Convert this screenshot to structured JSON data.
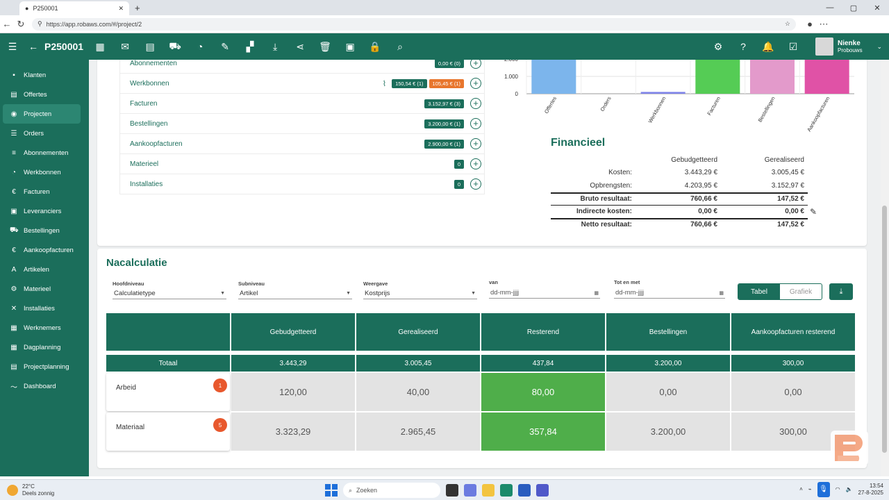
{
  "browser": {
    "tab_title": "P250001",
    "url": "https://app.robaws.com/#/project/2"
  },
  "appbar": {
    "project_code": "P250001",
    "user_name": "Nienke",
    "user_company": "Probouws"
  },
  "sidebar": {
    "items": [
      {
        "label": "Klanten",
        "icon": "person-icon"
      },
      {
        "label": "Offertes",
        "icon": "document-icon"
      },
      {
        "label": "Projecten",
        "icon": "project-icon",
        "active": true
      },
      {
        "label": "Orders",
        "icon": "list-icon"
      },
      {
        "label": "Abonnementen",
        "icon": "subscription-icon"
      },
      {
        "label": "Werkbonnen",
        "icon": "timer-icon"
      },
      {
        "label": "Facturen",
        "icon": "euro-icon"
      },
      {
        "label": "Leveranciers",
        "icon": "supplier-icon"
      },
      {
        "label": "Bestellingen",
        "icon": "cart-icon"
      },
      {
        "label": "Aankoopfacturen",
        "icon": "euro-icon"
      },
      {
        "label": "Artikelen",
        "icon": "article-icon"
      },
      {
        "label": "Materieel",
        "icon": "equipment-icon"
      },
      {
        "label": "Installaties",
        "icon": "tools-icon"
      },
      {
        "label": "Werknemers",
        "icon": "employees-icon"
      },
      {
        "label": "Dagplanning",
        "icon": "planning-icon"
      },
      {
        "label": "Projectplanning",
        "icon": "project-planning-icon"
      },
      {
        "label": "Dashboard",
        "icon": "chart-icon"
      }
    ]
  },
  "documents": {
    "rows": [
      {
        "label": "Abonnementen",
        "pills": [
          "0,00 € (0)"
        ]
      },
      {
        "label": "Werkbonnen",
        "pills": [
          "150,54 € (1)",
          "105,45 € (1)"
        ],
        "has_attachment": true
      },
      {
        "label": "Facturen",
        "pills": [
          "3.152,97 € (3)"
        ]
      },
      {
        "label": "Bestellingen",
        "pills": [
          "3.200,00 € (1)"
        ]
      },
      {
        "label": "Aankoopfacturen",
        "pills": [
          "2.900,00 € (1)"
        ]
      },
      {
        "label": "Materieel",
        "pills": [
          "0"
        ]
      },
      {
        "label": "Installaties",
        "pills": [
          "0"
        ]
      }
    ]
  },
  "chart_data": {
    "type": "bar",
    "categories": [
      "Offertes",
      "Orders",
      "Werkbonnen",
      "Facturen",
      "Bestellingen",
      "Aankoopfacturen"
    ],
    "values": [
      4203.95,
      0,
      105.45,
      3152.97,
      3200,
      2900
    ],
    "colors": [
      "#7cb5ec",
      "#8085e9",
      "#8085e9",
      "#55cc55",
      "#e39acb",
      "#e052a6"
    ],
    "yticks": [
      "0",
      "1.000",
      "2.000"
    ],
    "ylim": [
      0,
      2600
    ]
  },
  "financieel": {
    "title": "Financieel",
    "col_budget": "Gebudgetteerd",
    "col_real": "Gerealiseerd",
    "rows": [
      {
        "label": "Kosten:",
        "budget": "3.443,29 €",
        "real": "3.005,45 €"
      },
      {
        "label": "Opbrengsten:",
        "budget": "4.203,95 €",
        "real": "3.152,97 €"
      },
      {
        "label": "Bruto resultaat:",
        "budget": "760,66 €",
        "real": "147,52 €"
      },
      {
        "label": "Indirecte kosten:",
        "budget": "0,00 €",
        "real": "0,00 €"
      },
      {
        "label": "Netto resultaat:",
        "budget": "760,66 €",
        "real": "147,52 €"
      }
    ]
  },
  "nacalculatie": {
    "title": "Nacalculatie",
    "filters": {
      "hoofdniveau_label": "Hoofdniveau",
      "hoofdniveau_value": "Calculatietype",
      "subniveau_label": "Subniveau",
      "subniveau_value": "Artikel",
      "weergave_label": "Weergave",
      "weergave_value": "Kostprijs",
      "van_label": "van",
      "van_placeholder": "dd-mm-jjjj",
      "tot_label": "Tot en met",
      "tot_placeholder": "dd-mm-jjjj"
    },
    "toggle": {
      "tabel": "Tabel",
      "grafiek": "Grafiek"
    },
    "columns": [
      "",
      "Gebudgetteerd",
      "Gerealiseerd",
      "Resterend",
      "Bestellingen",
      "Aankoopfacturen resterend"
    ],
    "total": [
      "Totaal",
      "3.443,29",
      "3.005,45",
      "437,84",
      "3.200,00",
      "300,00"
    ],
    "rows": [
      {
        "label": "Arbeid",
        "badge": "1",
        "values": [
          "120,00",
          "40,00",
          "80,00",
          "0,00",
          "0,00"
        ]
      },
      {
        "label": "Materiaal",
        "badge": "5",
        "values": [
          "3.323,29",
          "2.965,45",
          "357,84",
          "3.200,00",
          "300,00"
        ]
      }
    ]
  },
  "taskbar": {
    "temp": "22°C",
    "weather": "Deels zonnig",
    "search": "Zoeken",
    "time": "13:54",
    "date": "27-8-2025"
  }
}
